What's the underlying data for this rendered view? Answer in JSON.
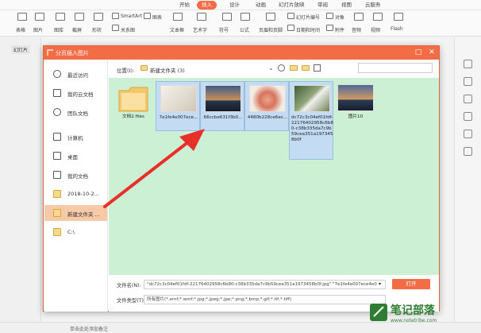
{
  "menubar": {
    "tabs": [
      "开始",
      "插入",
      "设计",
      "动画",
      "幻灯片放映",
      "审阅",
      "视图",
      "云服务"
    ],
    "active_tab_index": 1
  },
  "toolbar": {
    "items": [
      {
        "label": "表格",
        "icon": "table-icon"
      },
      {
        "label": "图片",
        "icon": "picture-icon"
      },
      {
        "label": "图库",
        "icon": "gallery-icon"
      },
      {
        "label": "截屏",
        "icon": "screenshot-icon"
      },
      {
        "label": "形状",
        "icon": "shape-icon"
      },
      {
        "label": "SmartArt",
        "icon": "smartart-icon"
      },
      {
        "label": "图表",
        "icon": "chart-icon"
      },
      {
        "label": "关系图",
        "icon": "relation-icon"
      },
      {
        "label": "文本框",
        "icon": "textbox-icon"
      },
      {
        "label": "艺术字",
        "icon": "wordart-icon"
      },
      {
        "label": "符号",
        "icon": "symbol-icon"
      },
      {
        "label": "公式",
        "icon": "formula-icon"
      },
      {
        "label": "页眉和页脚",
        "icon": "header-footer-icon"
      },
      {
        "label": "幻灯片编号",
        "icon": "slide-number-icon"
      },
      {
        "label": "对象",
        "icon": "object-icon"
      },
      {
        "label": "日期和时间",
        "icon": "datetime-icon"
      },
      {
        "label": "附件",
        "icon": "attachment-icon"
      },
      {
        "label": "音频",
        "icon": "audio-icon"
      },
      {
        "label": "视频",
        "icon": "video-icon"
      },
      {
        "label": "Flash",
        "icon": "flash-icon"
      }
    ]
  },
  "left_panel": {
    "slide_tab": "幻灯片"
  },
  "dialog": {
    "title": "分页插入图片",
    "close_glyph": "✕",
    "maximize_glyph": "□",
    "sidebar": [
      {
        "label": "最近访问",
        "icon": "clock-icon"
      },
      {
        "label": "我的云文档",
        "icon": "cloud-doc-icon"
      },
      {
        "label": "团队文档",
        "icon": "team-doc-icon"
      },
      {
        "label": "计算机",
        "icon": "computer-icon"
      },
      {
        "label": "桌面",
        "icon": "desktop-icon"
      },
      {
        "label": "我的文档",
        "icon": "my-docs-icon"
      },
      {
        "label": "2018-10-2...",
        "icon": "folder-icon"
      },
      {
        "label": "新建文件夹 ...",
        "icon": "folder-icon",
        "selected": true
      },
      {
        "label": "C:\\",
        "icon": "folder-icon"
      }
    ],
    "location": {
      "label": "位置(I):",
      "value": "新建文件夹 (3)",
      "search_placeholder": ""
    },
    "files": [
      {
        "name": "文档2.files",
        "type": "folder",
        "selected": false
      },
      {
        "name": "7e1fe4e007ece...",
        "type": "image",
        "selected": true
      },
      {
        "name": "66ccbe631f3b0...",
        "type": "image",
        "selected": true
      },
      {
        "name": "4480b228ce6ec...",
        "type": "image",
        "selected": true
      },
      {
        "name": "dc72c3c04ef01fdf-22176402958c6b80-c38b335da7c9b59cea351a1973458b0f",
        "type": "image",
        "selected": true
      },
      {
        "name": "图片10",
        "type": "image",
        "selected": false
      }
    ],
    "filename_label": "文件名(N):",
    "filename_value": "\"dc72c3c04ef01fdf-22176402958c6b80-c38b335da7c9b59cea351a1973458b0f.jpg\" \"7e1fe4e007ece4e0",
    "filetype_label": "文件类型(T):",
    "filetype_value": "所有图片(*.emf;*.wmf;*.jpg;*.jpeg;*.jpe;*.png;*.bmp;*.gif;*.tif;*.tiff)",
    "open_button": "打开"
  },
  "statusbar": {
    "text": "单击此处添加备注"
  },
  "watermark": {
    "text": "笔记部落",
    "url": "www.notetribe.com"
  },
  "colors": {
    "accent": "#f26c46",
    "file_area": "#ccf0d4",
    "selection": "#c4dcf3",
    "arrow": "#e8302a"
  }
}
